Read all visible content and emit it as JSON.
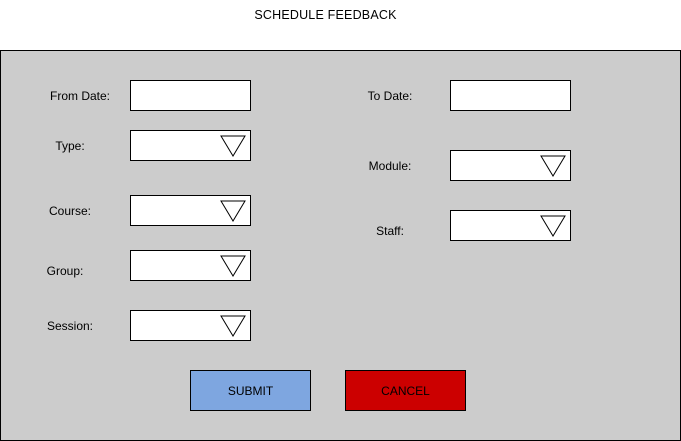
{
  "title": "SCHEDULE FEEDBACK",
  "colors": {
    "panel": "#cccccc",
    "submit": "#7ea6e0",
    "cancel": "#cc0000"
  },
  "form": {
    "from_date": {
      "label": "From Date:",
      "value": ""
    },
    "to_date": {
      "label": "To Date:",
      "value": ""
    },
    "type": {
      "label": "Type:",
      "value": "",
      "icon": "dropdown-triangle-icon"
    },
    "module": {
      "label": "Module:",
      "value": "",
      "icon": "dropdown-triangle-icon"
    },
    "course": {
      "label": "Course:",
      "value": "",
      "icon": "dropdown-triangle-icon"
    },
    "staff": {
      "label": "Staff:",
      "value": "",
      "icon": "dropdown-triangle-icon"
    },
    "group": {
      "label": "Group:",
      "value": "",
      "icon": "dropdown-triangle-icon"
    },
    "session": {
      "label": "Session:",
      "value": "",
      "icon": "dropdown-triangle-icon"
    }
  },
  "buttons": {
    "submit": "SUBMIT",
    "cancel": "CANCEL"
  }
}
